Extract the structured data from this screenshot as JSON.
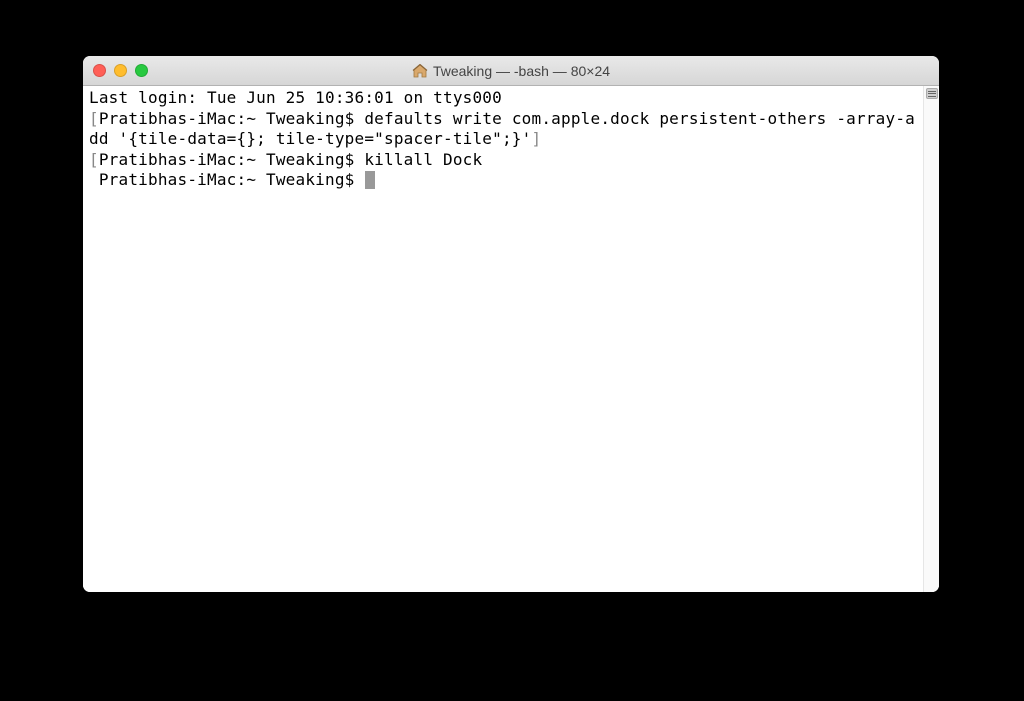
{
  "window": {
    "title": "Tweaking — -bash — 80×24"
  },
  "terminal": {
    "last_login": "Last login: Tue Jun 25 10:36:01 on ttys000",
    "prompt": "Pratibhas-iMac:~ Tweaking$ ",
    "cmd1": "defaults write com.apple.dock persistent-others -array-add '{tile-data={}; tile-type=\"spacer-tile\";}'",
    "cmd2": "killall Dock",
    "left_bracket": "[",
    "right_bracket": "]"
  }
}
